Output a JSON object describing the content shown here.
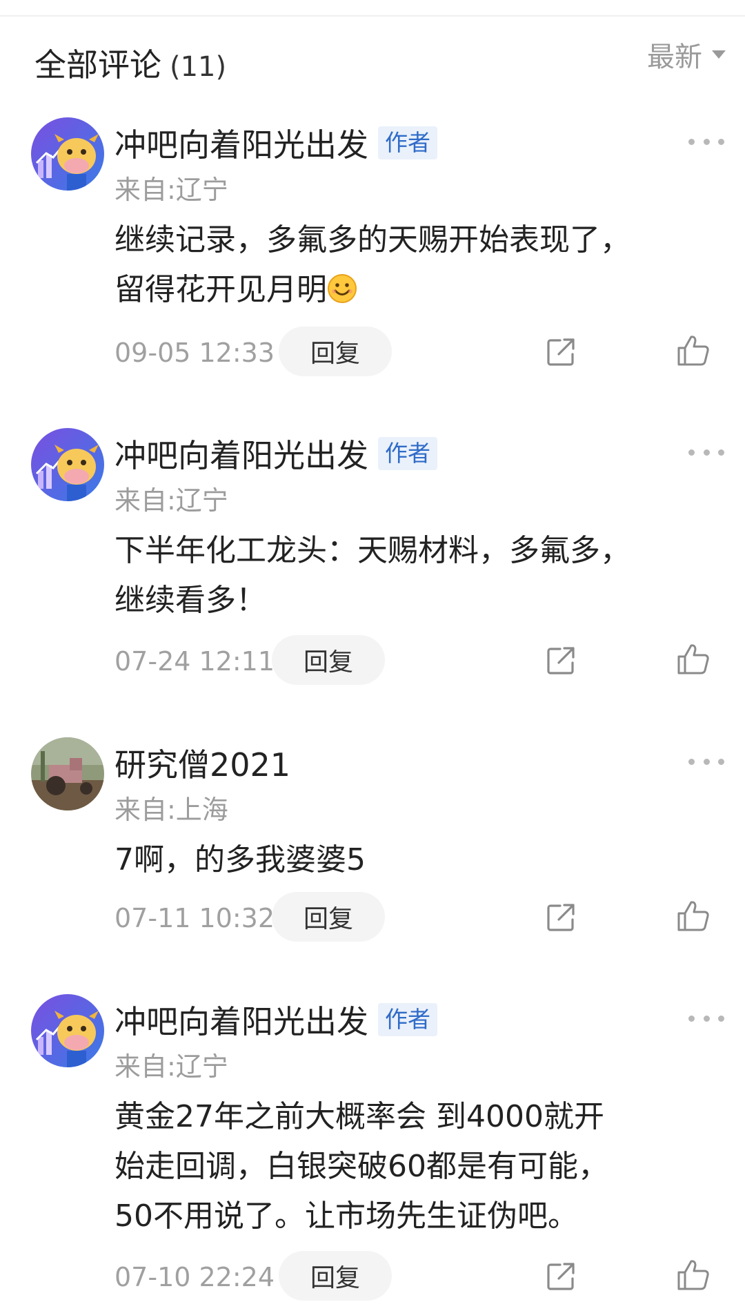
{
  "header": {
    "title": "全部评论",
    "count": "(11)",
    "sort_label": "最新"
  },
  "comments": [
    {
      "author": "冲吧向着阳光出发",
      "badge": "作者",
      "location": "来自:辽宁",
      "lines": [
        "继续记录，多氟多的天赐开始表现了，",
        "留得花开见月明"
      ],
      "has_emoji": true,
      "time": "09-05 12:33",
      "reply_label": "回复",
      "avatar": "cow-mascot"
    },
    {
      "author": "冲吧向着阳光出发",
      "badge": "作者",
      "location": "来自:辽宁",
      "lines": [
        "下半年化工龙头：天赐材料，多氟多，",
        "继续看多！"
      ],
      "time": "07-24 12:11",
      "reply_label": "回复",
      "avatar": "cow-mascot"
    },
    {
      "author": "研究僧2021",
      "location": "来自:上海",
      "lines": [
        "7啊，的多我婆婆5"
      ],
      "time": "07-11 10:32",
      "reply_label": "回复",
      "avatar": "tractor-photo"
    },
    {
      "author": "冲吧向着阳光出发",
      "badge": "作者",
      "location": "来自:辽宁",
      "lines": [
        "黄金27年之前大概率会 到4000就开",
        "始走回调，白银突破60都是有可能，",
        "50不用说了。让市场先生证伪吧。"
      ],
      "time": "07-10 22:24",
      "reply_label": "回复",
      "avatar": "cow-mascot"
    }
  ],
  "colors": {
    "badge_bg": "#eaf1fb",
    "badge_text": "#2f6bc8",
    "muted": "#9c9c9c"
  },
  "icons": [
    "more-icon",
    "share-icon",
    "like-icon",
    "sort-caret-icon",
    "smile-emoji"
  ]
}
